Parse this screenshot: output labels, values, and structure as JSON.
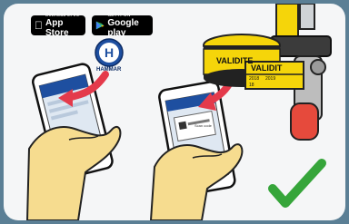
{
  "badges": {
    "appstore_small": "Download on the",
    "appstore_big": "App Store",
    "gplay_small": "GET IT ON",
    "gplay_big": "Google play"
  },
  "brand": {
    "logo_word": "HAMMAR",
    "logo_letter": "H"
  },
  "seal": {
    "valid_text": "VALIDITE",
    "valid_text_2": "VALIDIT",
    "year_1": "2018",
    "year_2": "2019",
    "day": "18"
  },
  "phone2": {
    "scan_label": "Scan code"
  },
  "colors": {
    "background": "#5b7f95",
    "arrow": "#e43a4b",
    "check": "#36a53a",
    "brand_blue": "#1e4fa0",
    "tag_yellow": "#f5d50a"
  }
}
